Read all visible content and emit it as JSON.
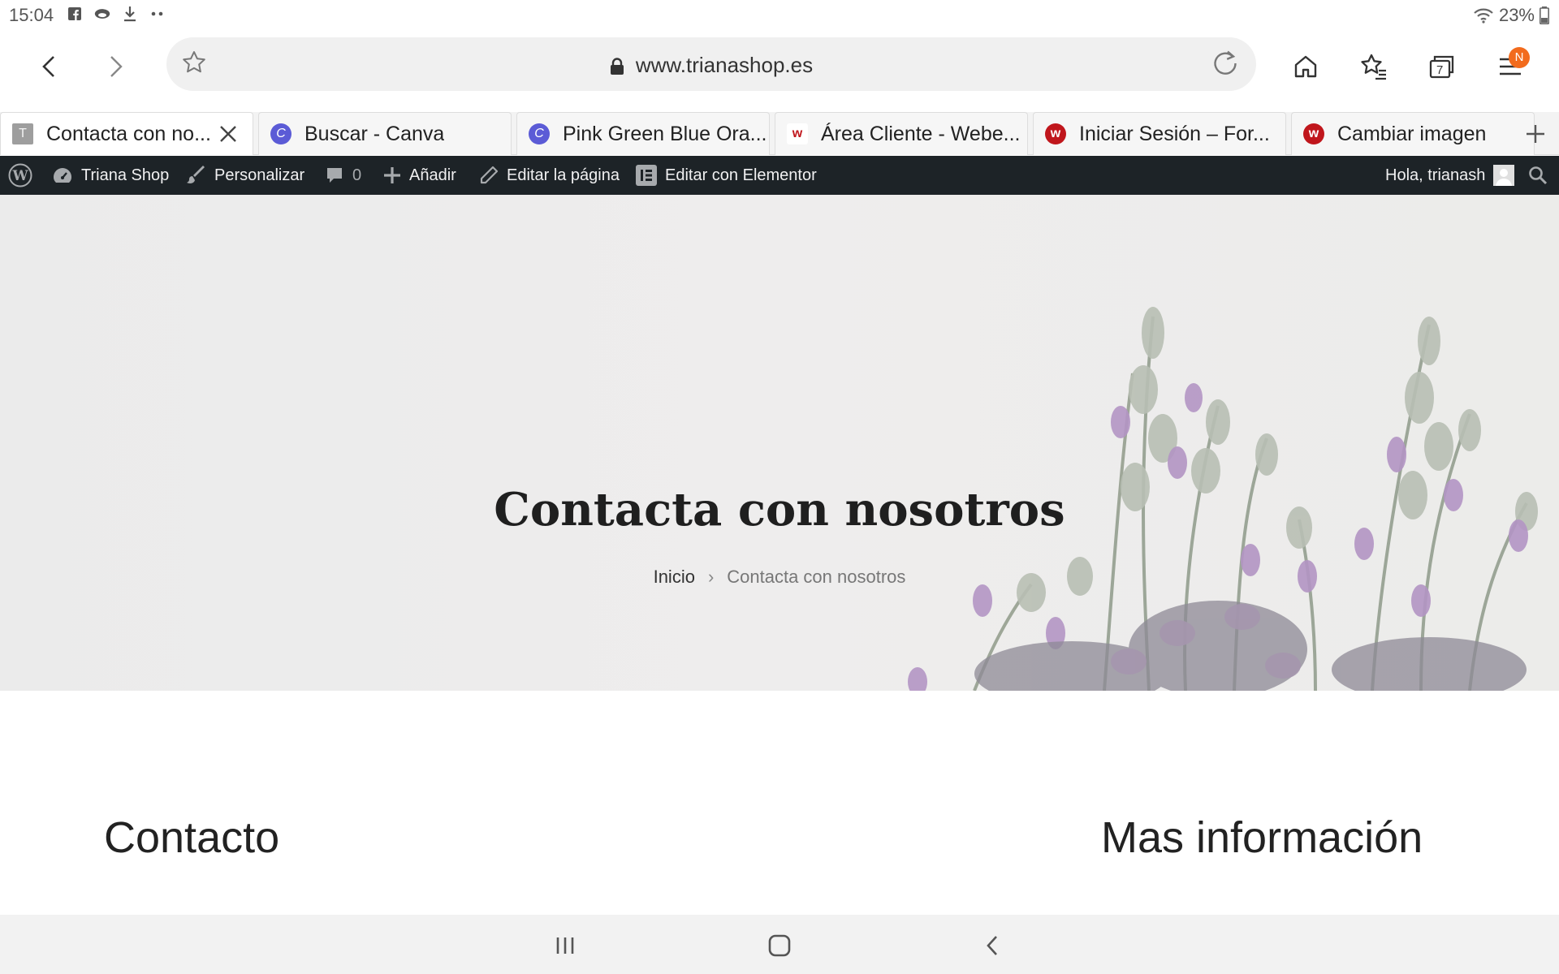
{
  "status": {
    "time": "15:04",
    "battery": "23%",
    "notif_icons": [
      "facebook-icon",
      "cloud-icon",
      "download-icon",
      "more-dots-icon"
    ]
  },
  "browser": {
    "url": "www.trianashop.es",
    "menu_badge": "N",
    "tabs": [
      {
        "title": "Contacta con no...",
        "favicon": "T",
        "active": true
      },
      {
        "title": "Buscar - Canva",
        "favicon": "C"
      },
      {
        "title": "Pink Green Blue Ora...",
        "favicon": "C"
      },
      {
        "title": "Área Cliente - Webe...",
        "favicon": "w"
      },
      {
        "title": "Iniciar Sesión – For...",
        "favicon": "w"
      },
      {
        "title": "Cambiar imagen",
        "favicon": "w"
      }
    ]
  },
  "adminbar": {
    "site_name": "Triana Shop",
    "customize": "Personalizar",
    "comments_count": "0",
    "add_new": "Añadir",
    "edit_page": "Editar la página",
    "edit_elementor": "Editar con Elementor",
    "greeting": "Hola, trianash"
  },
  "hero": {
    "title": "Contacta con nosotros",
    "breadcrumb_home": "Inicio",
    "breadcrumb_sep": "›",
    "breadcrumb_current": "Contacta con nosotros"
  },
  "content": {
    "left_heading": "Contacto",
    "right_heading": "Mas información"
  },
  "colors": {
    "adminbar_bg": "#1d2327",
    "badge": "#f26b1d",
    "canva": "#5b5bd6",
    "webempresa": "#c0161c"
  }
}
